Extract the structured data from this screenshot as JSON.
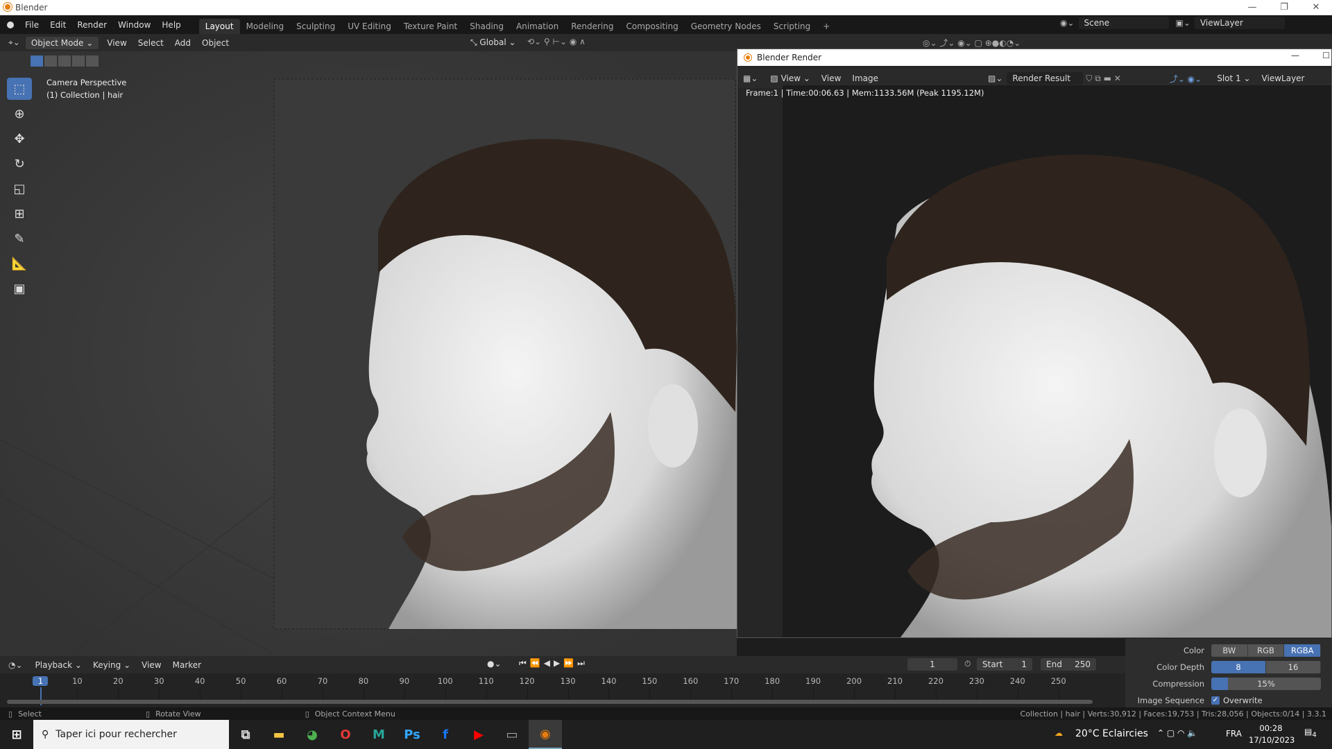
{
  "window": {
    "title": "Blender",
    "min": "—",
    "max": "❐",
    "close": "✕"
  },
  "menu": [
    "File",
    "Edit",
    "Render",
    "Window",
    "Help"
  ],
  "workspaces": [
    "Layout",
    "Modeling",
    "Sculpting",
    "UV Editing",
    "Texture Paint",
    "Shading",
    "Animation",
    "Rendering",
    "Compositing",
    "Geometry Nodes",
    "Scripting",
    "+"
  ],
  "scene": "Scene",
  "viewlayer": "ViewLayer",
  "header": {
    "mode": "Object Mode",
    "items": [
      "View",
      "Select",
      "Add",
      "Object"
    ],
    "orientation": "Global"
  },
  "viewport": {
    "line1": "Camera Perspective",
    "line2": "(1) Collection | hair"
  },
  "render": {
    "title": "Blender Render",
    "view_menu": "View",
    "menus": [
      "View",
      "Image"
    ],
    "image_name": "Render Result",
    "slot": "Slot 1",
    "layer": "ViewLayer",
    "info": "Frame:1 | Time:00:06.63 | Mem:1133.56M (Peak 1195.12M)"
  },
  "timeline": {
    "menus": [
      "Playback",
      "Keying",
      "View",
      "Marker"
    ],
    "current_frame": "1",
    "start_label": "Start",
    "start": "1",
    "end_label": "End",
    "end": "250",
    "ticks": [
      "1",
      "10",
      "20",
      "30",
      "40",
      "50",
      "60",
      "70",
      "80",
      "90",
      "100",
      "110",
      "120",
      "130",
      "140",
      "150",
      "160",
      "170",
      "180",
      "190",
      "200",
      "210",
      "220",
      "230",
      "240",
      "250"
    ]
  },
  "props": {
    "color_label": "Color",
    "color_opts": [
      "BW",
      "RGB",
      "RGBA"
    ],
    "depth_label": "Color Depth",
    "depth_opts": [
      "8",
      "16"
    ],
    "compression_label": "Compression",
    "compression": "15%",
    "compression_value": 15,
    "seq_label": "Image Sequence",
    "overwrite": "Overwrite"
  },
  "status": {
    "select": "Select",
    "rotate": "Rotate View",
    "context": "Object Context Menu",
    "stats": "Collection | hair | Verts:30,912 | Faces:19,753 | Tris:28,056 | Objects:0/14 | 3.3.1"
  },
  "taskbar": {
    "search": "Taper ici pour rechercher",
    "weather": "20°C  Eclaircies",
    "lang": "FRA",
    "time": "00:28",
    "date": "17/10/2023",
    "notif": "4"
  }
}
